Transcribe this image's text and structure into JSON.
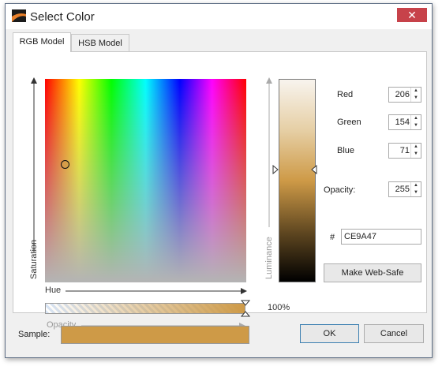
{
  "window": {
    "title": "Select Color",
    "close_glyph": "✕"
  },
  "tabs": [
    {
      "label": "RGB Model",
      "active": true
    },
    {
      "label": "HSB Model",
      "active": false
    }
  ],
  "gradient": {
    "x_label": "Hue",
    "y_label": "Saturation"
  },
  "luminance": {
    "label": "Luminance"
  },
  "opacity_bar": {
    "label": "Opacity",
    "percent_text": "100%"
  },
  "fields": {
    "red": {
      "label": "Red",
      "value": "206"
    },
    "green": {
      "label": "Green",
      "value": "154"
    },
    "blue": {
      "label": "Blue",
      "value": "71"
    },
    "opacity": {
      "label": "Opacity:",
      "value": "255"
    }
  },
  "hex": {
    "prefix": "#",
    "value": "CE9A47"
  },
  "buttons": {
    "web_safe": "Make Web-Safe",
    "ok": "OK",
    "cancel": "Cancel"
  },
  "sample": {
    "label": "Sample:",
    "color": "#ce9a47"
  },
  "colors": {
    "close_red": "#c7424a",
    "selected": "#ce9a47"
  }
}
